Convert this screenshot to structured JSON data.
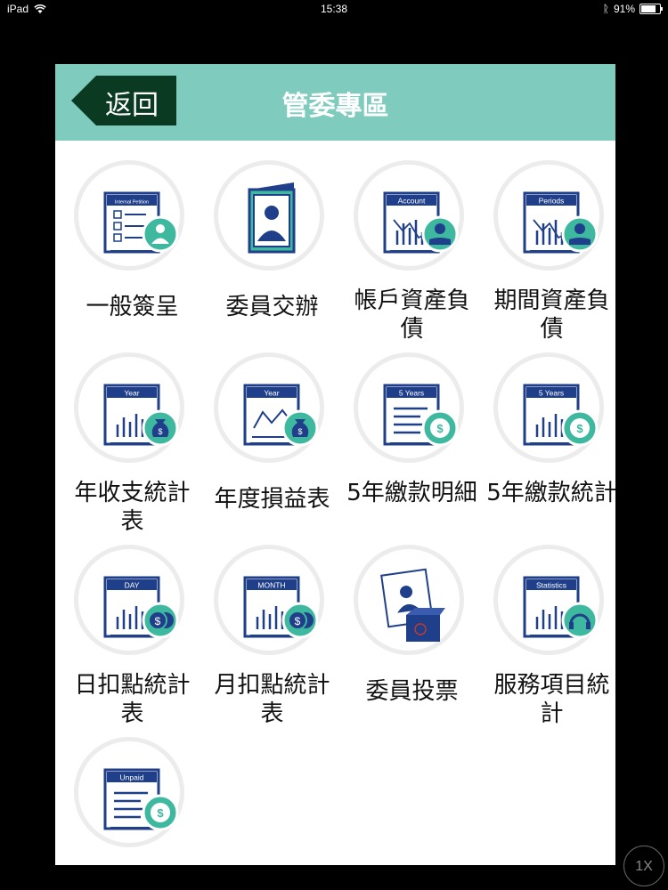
{
  "status_bar": {
    "device": "iPad",
    "time": "15:38",
    "battery": "91%",
    "battery_level": 0.91
  },
  "header": {
    "back_label": "返回",
    "title": "管委專區"
  },
  "menu": [
    {
      "label": "一般簽呈",
      "icon": "petition-document-icon",
      "badge": "Internal Petition"
    },
    {
      "label": "委員交辦",
      "icon": "committee-member-icon",
      "badge": ""
    },
    {
      "label": "帳戶資產負債",
      "icon": "account-chart-icon",
      "badge": "Account"
    },
    {
      "label": "期間資產負債",
      "icon": "periods-chart-icon",
      "badge": "Periods"
    },
    {
      "label": "年收支統計表",
      "icon": "year-income-chart-icon",
      "badge": "Year"
    },
    {
      "label": "年度損益表",
      "icon": "year-profit-loss-icon",
      "badge": "Year"
    },
    {
      "label": "5年繳款明細",
      "icon": "five-year-payment-detail-icon",
      "badge": "5 Years"
    },
    {
      "label": "5年繳款統計",
      "icon": "five-year-payment-stats-icon",
      "badge": "5 Years"
    },
    {
      "label": "日扣點統計表",
      "icon": "daily-points-chart-icon",
      "badge": "DAY"
    },
    {
      "label": "月扣點統計表",
      "icon": "monthly-points-chart-icon",
      "badge": "MONTH"
    },
    {
      "label": "委員投票",
      "icon": "committee-vote-icon",
      "badge": ""
    },
    {
      "label": "服務項目統計",
      "icon": "service-statistics-icon",
      "badge": "Statistics"
    },
    {
      "label": "",
      "icon": "unpaid-document-icon",
      "badge": "Unpaid"
    }
  ],
  "zoom_label": "1X",
  "colors": {
    "header": "#7fcbbd",
    "icon_blue": "#1f3f8a",
    "accent_teal": "#3fb8a0",
    "back_button": "#0a3a22"
  }
}
